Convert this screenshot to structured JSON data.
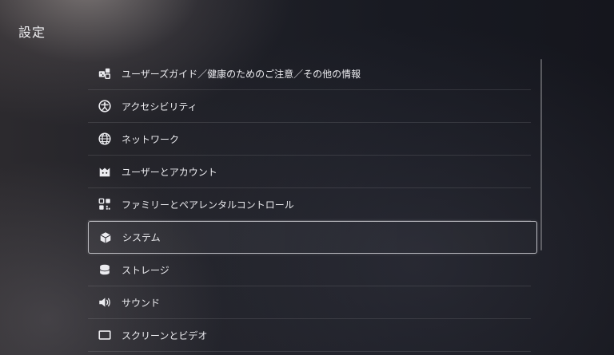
{
  "header": {
    "title": "設定"
  },
  "menu": {
    "selected_index": 5,
    "items": [
      {
        "label": "ユーザーズガイド／健康のためのご注意／その他の情報",
        "icon": "user-guide-icon"
      },
      {
        "label": "アクセシビリティ",
        "icon": "accessibility-icon"
      },
      {
        "label": "ネットワーク",
        "icon": "globe-icon"
      },
      {
        "label": "ユーザーとアカウント",
        "icon": "user-face-icon"
      },
      {
        "label": "ファミリーとペアレンタルコントロール",
        "icon": "family-icon"
      },
      {
        "label": "システム",
        "icon": "cube-icon"
      },
      {
        "label": "ストレージ",
        "icon": "storage-icon"
      },
      {
        "label": "サウンド",
        "icon": "speaker-icon"
      },
      {
        "label": "スクリーンとビデオ",
        "icon": "screen-icon"
      }
    ]
  }
}
